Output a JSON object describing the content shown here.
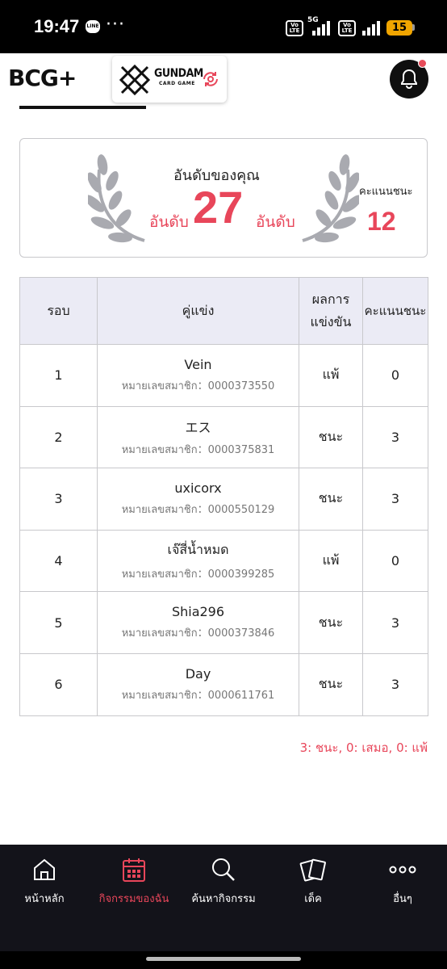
{
  "status_bar": {
    "time": "19:47",
    "line_badge": "LINE",
    "network_1": "5G",
    "volte": "Vo LTE",
    "battery": "15"
  },
  "header": {
    "app_logo": "BCG+",
    "game_logo_title": "GUNDAM",
    "game_logo_subtitle": "CARD GAME"
  },
  "rank": {
    "title": "อันดับของคุณ",
    "prefix": "อันดับ",
    "number": "27",
    "suffix": "อันดับ",
    "wins_label": "คะแนนชนะ",
    "wins_value": "12"
  },
  "table": {
    "headers": {
      "round": "รอบ",
      "opponent": "คู่แข่ง",
      "result_line1": "ผลการ",
      "result_line2": "แข่งขัน",
      "points": "คะแนนชนะ"
    },
    "rows": [
      {
        "round": "1",
        "name": "Vein",
        "member": "หมายเลขสมาชิก：0000373550",
        "result": "แพ้",
        "points": "0"
      },
      {
        "round": "2",
        "name": "エス",
        "member": "หมายเลขสมาชิก：0000375831",
        "result": "ชนะ",
        "points": "3"
      },
      {
        "round": "3",
        "name": "uxicorx",
        "member": "หมายเลขสมาชิก：0000550129",
        "result": "ชนะ",
        "points": "3"
      },
      {
        "round": "4",
        "name": "เจ๊สี่น้ำหมด",
        "member": "หมายเลขสมาชิก：0000399285",
        "result": "แพ้",
        "points": "0"
      },
      {
        "round": "5",
        "name": "Shia296",
        "member": "หมายเลขสมาชิก：0000373846",
        "result": "ชนะ",
        "points": "3"
      },
      {
        "round": "6",
        "name": "Day",
        "member": "หมายเลขสมาชิก：0000611761",
        "result": "ชนะ",
        "points": "3"
      }
    ]
  },
  "legend": "3: ชนะ, 0: เสมอ, 0: แพ้",
  "bottom_nav": {
    "items": [
      {
        "label": "หน้าหลัก",
        "icon": "home-icon"
      },
      {
        "label": "กิจกรรมของฉัน",
        "icon": "calendar-icon"
      },
      {
        "label": "ค้นหากิจกรรม",
        "icon": "search-icon"
      },
      {
        "label": "เด็ค",
        "icon": "cards-icon"
      },
      {
        "label": "อื่นๆ",
        "icon": "more-icon"
      }
    ],
    "active_index": 1
  },
  "colors": {
    "accent": "#e8465a",
    "header_bg": "#ebebf5",
    "nav_bg": "#13131a"
  }
}
